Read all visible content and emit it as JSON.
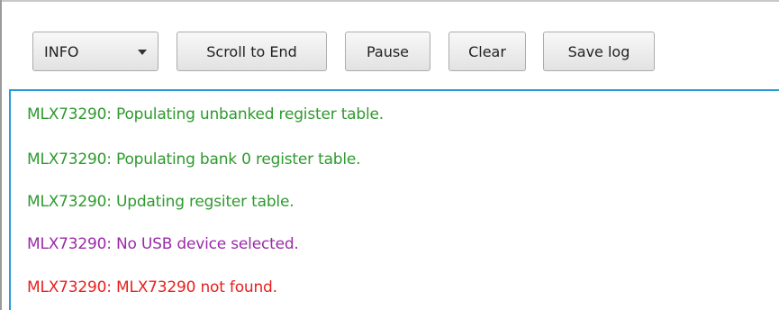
{
  "toolbar": {
    "level_select": {
      "value": "INFO",
      "icon": "chevron-down-icon"
    },
    "scroll_to_end_label": "Scroll to End",
    "pause_label": "Pause",
    "clear_label": "Clear",
    "save_log_label": "Save log"
  },
  "colors": {
    "info": "#2e9a2e",
    "warning": "#9a2aa8",
    "error": "#e8201e",
    "focus_border": "#2a9bd8"
  },
  "log": {
    "lines": [
      {
        "text": "MLX73290:  Populating unbanked register table.",
        "level": "info"
      },
      {
        "text": "MLX73290:  Populating bank 0 register table.",
        "level": "info"
      },
      {
        "text": "MLX73290:  Updating regsiter table.",
        "level": "info"
      },
      {
        "text": "MLX73290:  No USB device selected.",
        "level": "warning"
      },
      {
        "text": "MLX73290:  MLX73290 not found.",
        "level": "error"
      }
    ]
  }
}
